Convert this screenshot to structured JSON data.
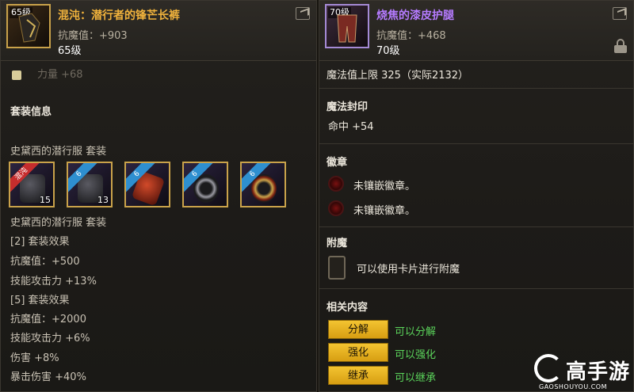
{
  "left_item": {
    "level_badge": "65级",
    "name": "混沌：潜行者的锋芒长裤",
    "stat": "抗魔值：+903",
    "level": "65级",
    "icon": "share-icon"
  },
  "left_body": {
    "top_cut_text": "力量 +68",
    "set_info_title": "套装信息",
    "set_name": "史黛西的潜行服 套装",
    "set_name_2": "史黛西的潜行服 套装",
    "slots": [
      {
        "ribbon": "混沌",
        "count": "15",
        "ribbon_color": "#c62d2d"
      },
      {
        "ribbon": "6",
        "count": "13",
        "ribbon_color": "#2e8fd0"
      },
      {
        "ribbon": "6",
        "count": "",
        "ribbon_color": "#2e8fd0"
      },
      {
        "ribbon": "6",
        "count": "",
        "ribbon_color": "#2e8fd0"
      },
      {
        "ribbon": "6",
        "count": "",
        "ribbon_color": "#2e8fd0"
      }
    ],
    "effects": [
      "[2] 套装效果",
      "抗魔值：+500",
      "技能攻击力 +13%",
      "[5] 套装效果",
      "抗魔值：+2000",
      "技能攻击力 +6%",
      "伤害 +8%",
      "暴击伤害 +40%"
    ]
  },
  "right_item": {
    "level_badge": "70级",
    "name": "烧焦的漆皮护腿",
    "stat": "抗魔值：+468",
    "level": "70级",
    "name_color": "#b57bff"
  },
  "right_body": {
    "mp_line": "魔法值上限 325（实际2132）",
    "seal_title": "魔法封印",
    "seal_value": "命中 +54",
    "emblem_title": "徽章",
    "emblem_1": "未镶嵌徽章。",
    "emblem_2": "未镶嵌徽章。",
    "enchant_title": "附魔",
    "enchant_hint": "可以使用卡片进行附魔",
    "related_title": "相关内容",
    "buttons": [
      {
        "label": "分解",
        "desc": "可以分解"
      },
      {
        "label": "强化",
        "desc": "可以强化"
      },
      {
        "label": "继承",
        "desc": "可以继承"
      }
    ]
  },
  "watermark": {
    "text": "高手游",
    "url": "GAOSHOUYOU.COM"
  }
}
